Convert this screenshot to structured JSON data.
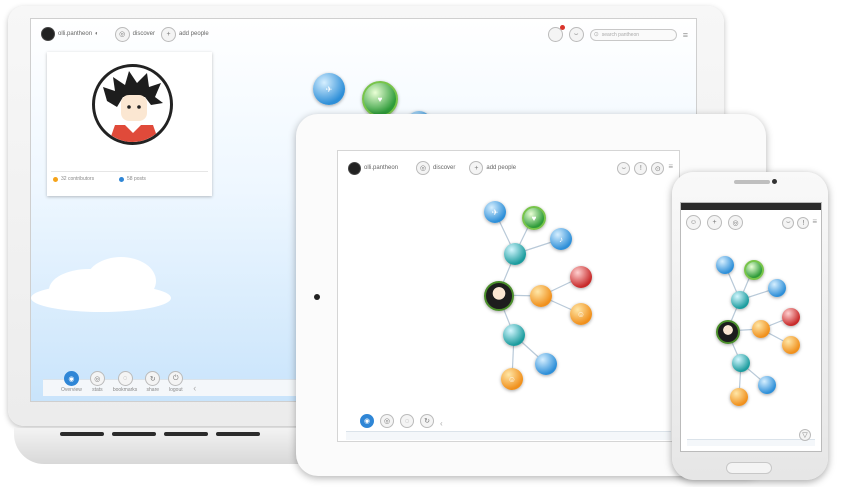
{
  "laptop": {
    "topbar": {
      "username": "olli.pantheon",
      "discover_label": "discover",
      "add_people_label": "add people",
      "search_placeholder": "search pantheon",
      "notification_count": ""
    },
    "profile_card": {
      "stat_left": "32 contributors",
      "stat_right": "58 posts"
    },
    "bottom_nav": [
      {
        "label": "Overview"
      },
      {
        "label": "stats"
      },
      {
        "label": "bookmarks"
      },
      {
        "label": "share"
      },
      {
        "label": "logout"
      }
    ]
  },
  "tablet": {
    "topbar": {
      "username": "olli.pantheon",
      "discover_label": "discover",
      "add_people_label": "add people"
    }
  },
  "phone": {},
  "colors": {
    "sky": "#c9e4fb",
    "node_blue": "#2e8fd8",
    "node_green": "#2f9c3a",
    "node_orange": "#f0901c",
    "node_red": "#c82a2a",
    "accent_orange": "#f5a31a",
    "accent_blue": "#2f86d6"
  },
  "icons": [
    "user-avatar-icon",
    "discover-icon",
    "add-people-icon",
    "notification-icon",
    "chat-icon",
    "search-icon",
    "menu-icon",
    "home-icon",
    "stats-icon",
    "bookmark-icon",
    "share-icon",
    "power-icon",
    "back-arrow-icon"
  ]
}
